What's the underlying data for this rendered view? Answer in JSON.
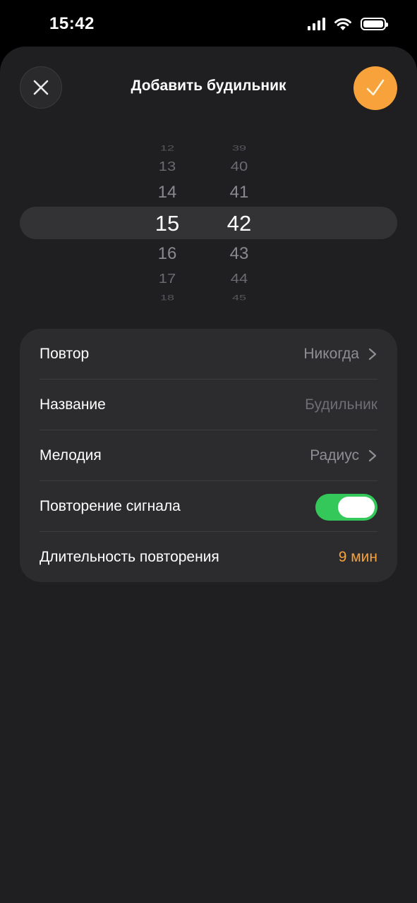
{
  "status_bar": {
    "time": "15:42",
    "icons": [
      "cellular-signal-icon",
      "wifi-icon",
      "battery-icon"
    ]
  },
  "header": {
    "title": "Добавить будильник",
    "close_icon": "close-icon",
    "confirm_icon": "checkmark-icon"
  },
  "picker": {
    "hours": [
      "12",
      "13",
      "14",
      "15",
      "16",
      "17",
      "18"
    ],
    "minutes": [
      "39",
      "40",
      "41",
      "42",
      "43",
      "44",
      "45"
    ],
    "selected_hour": "15",
    "selected_minute": "42"
  },
  "settings": {
    "repeat": {
      "label": "Повтор",
      "value": "Никогда"
    },
    "name": {
      "label": "Название",
      "placeholder": "Будильник"
    },
    "sound": {
      "label": "Мелодия",
      "value": "Радиус"
    },
    "snooze": {
      "label": "Повторение сигнала",
      "enabled": true
    },
    "snooze_duration": {
      "label": "Длительность повторения",
      "value": "9 мин"
    }
  },
  "colors": {
    "accent": "#f7a23a",
    "toggle_on": "#34c759",
    "background": "#1f1f21",
    "card": "#2c2c2e",
    "secondary_text": "#8e8e93"
  }
}
